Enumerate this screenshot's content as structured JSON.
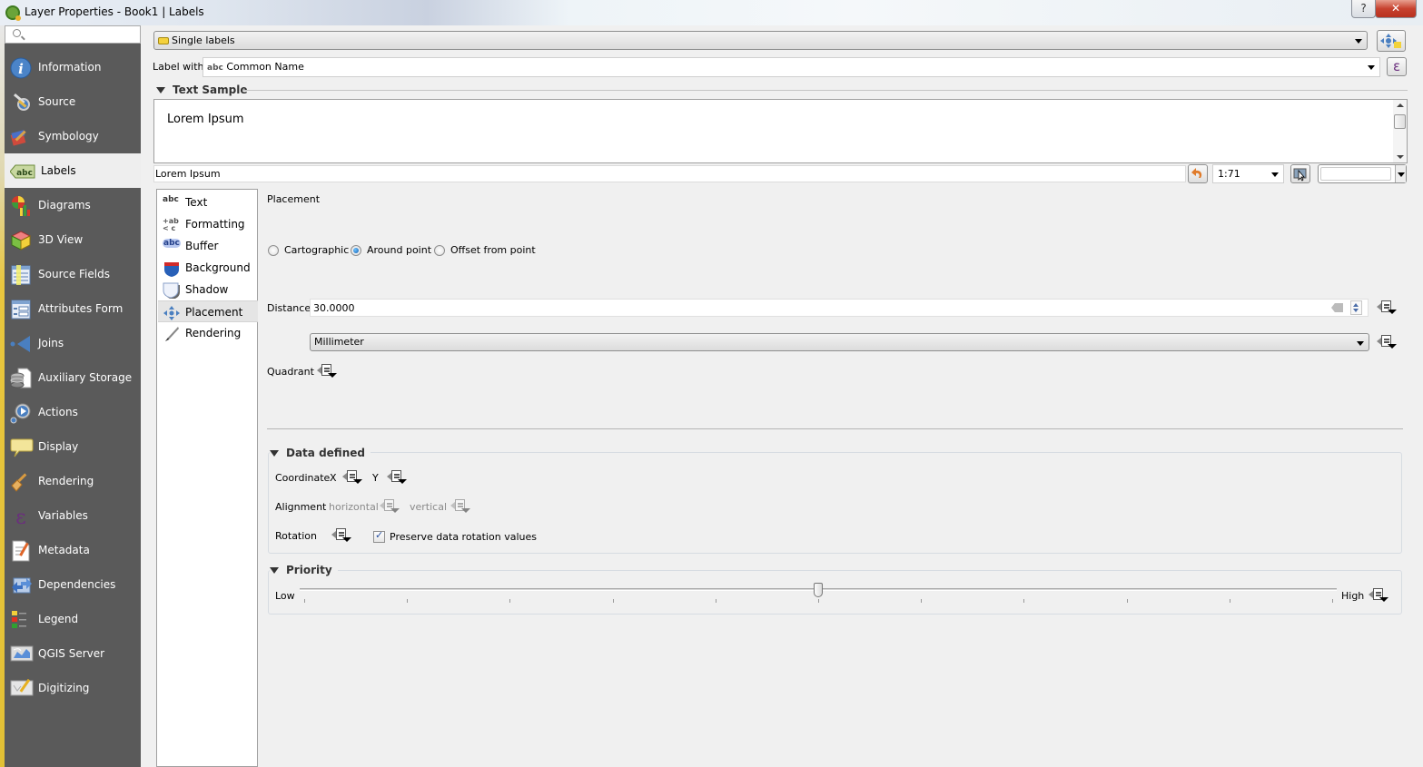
{
  "window": {
    "title": "Layer Properties - Book1 | Labels",
    "help_label": "?",
    "close_label": "✕"
  },
  "sidebar": {
    "search_placeholder": "",
    "items": [
      {
        "label": "Information",
        "icon": "information-icon",
        "active": false
      },
      {
        "label": "Source",
        "icon": "source-icon",
        "active": false
      },
      {
        "label": "Symbology",
        "icon": "symbology-icon",
        "active": false
      },
      {
        "label": "Labels",
        "icon": "labels-icon",
        "active": true
      },
      {
        "label": "Diagrams",
        "icon": "diagrams-icon",
        "active": false
      },
      {
        "label": "3D View",
        "icon": "3d-view-icon",
        "active": false
      },
      {
        "label": "Source Fields",
        "icon": "source-fields-icon",
        "active": false
      },
      {
        "label": "Attributes Form",
        "icon": "attributes-form-icon",
        "active": false
      },
      {
        "label": "Joins",
        "icon": "joins-icon",
        "active": false
      },
      {
        "label": "Auxiliary Storage",
        "icon": "auxiliary-storage-icon",
        "active": false
      },
      {
        "label": "Actions",
        "icon": "actions-icon",
        "active": false
      },
      {
        "label": "Display",
        "icon": "display-icon",
        "active": false
      },
      {
        "label": "Rendering",
        "icon": "rendering-icon",
        "active": false
      },
      {
        "label": "Variables",
        "icon": "variables-icon",
        "active": false
      },
      {
        "label": "Metadata",
        "icon": "metadata-icon",
        "active": false
      },
      {
        "label": "Dependencies",
        "icon": "dependencies-icon",
        "active": false
      },
      {
        "label": "Legend",
        "icon": "legend-icon",
        "active": false
      },
      {
        "label": "QGIS Server",
        "icon": "qgis-server-icon",
        "active": false
      },
      {
        "label": "Digitizing",
        "icon": "digitizing-icon",
        "active": false
      }
    ]
  },
  "labels": {
    "mode": "Single labels",
    "label_with_caption": "Label with",
    "label_with_prefix": "abc",
    "label_with_value": "Common Name",
    "expression_symbol": "ε"
  },
  "text_sample": {
    "header": "Text Sample",
    "preview_text": "Lorem Ipsum",
    "input_value": "Lorem Ipsum",
    "scale": "1:71",
    "bg_color_value": ""
  },
  "tabs": [
    {
      "label": "Text",
      "icon": "text-icon",
      "glyph": "abc"
    },
    {
      "label": "Formatting",
      "icon": "formatting-icon",
      "glyph": "+ab"
    },
    {
      "label": "Buffer",
      "icon": "buffer-icon",
      "glyph": "abc"
    },
    {
      "label": "Background",
      "icon": "background-icon",
      "glyph": ""
    },
    {
      "label": "Shadow",
      "icon": "shadow-icon",
      "glyph": ""
    },
    {
      "label": "Placement",
      "icon": "placement-icon",
      "glyph": ""
    },
    {
      "label": "Rendering",
      "icon": "rendering-brush-icon",
      "glyph": ""
    }
  ],
  "placement": {
    "title": "Placement",
    "modes": [
      {
        "label": "Cartographic",
        "selected": false
      },
      {
        "label": "Around point",
        "selected": true
      },
      {
        "label": "Offset from point",
        "selected": false
      }
    ],
    "distance_label": "Distance",
    "distance_value": "30.0000",
    "unit": "Millimeter",
    "quadrant_label": "Quadrant"
  },
  "data_defined": {
    "header": "Data defined",
    "coordinate_label": "Coordinate",
    "x_label": "X",
    "y_label": "Y",
    "alignment_label": "Alignment",
    "horizontal_label": "horizontal",
    "vertical_label": "vertical",
    "rotation_label": "Rotation",
    "preserve_rotation_label": "Preserve data rotation values",
    "preserve_rotation_checked": true
  },
  "priority": {
    "header": "Priority",
    "low_label": "Low",
    "high_label": "High",
    "min": 0,
    "max": 10,
    "value": 5
  }
}
